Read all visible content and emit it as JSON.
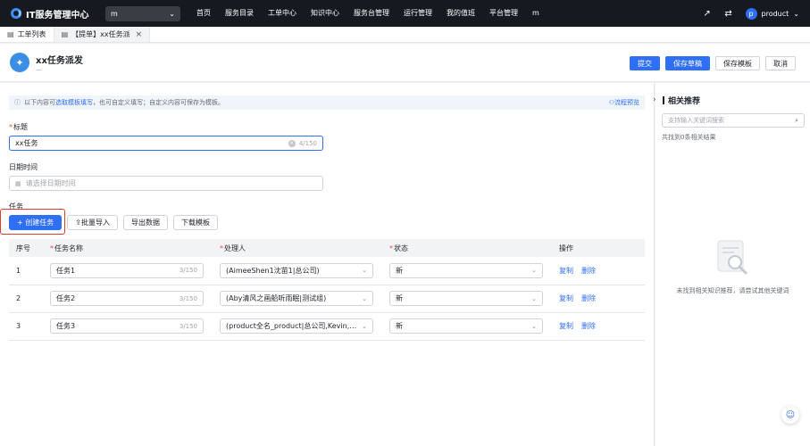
{
  "topnav": {
    "app_title": "IT服务管理中心",
    "system_select": "m",
    "items": [
      "首页",
      "服务目录",
      "工单中心",
      "知识中心",
      "服务台管理",
      "运行管理",
      "我的值班",
      "平台管理",
      "m"
    ],
    "user_initial": "p",
    "user_name": "product"
  },
  "tabs": [
    {
      "label": "工单列表",
      "icon": "document-icon"
    },
    {
      "label": "【提单】xx任务派",
      "icon": "document-icon",
      "close": "×"
    }
  ],
  "header": {
    "title": "xx任务派发",
    "subtitle": "—",
    "buttons": {
      "submit": "提交",
      "save_draft": "保存草稿",
      "save_template": "保存模板",
      "cancel": "取消"
    }
  },
  "notice": {
    "prefix": "以下内容可",
    "link": "选取模板填写",
    "suffix": "，也可自定义填写；自定义内容可保存为模板。",
    "flow_preview": "流程预览"
  },
  "form": {
    "title_label": "标题",
    "title_value": "xx任务",
    "title_counter": "4/150",
    "date_label": "日期时间",
    "date_placeholder": "请选择日期时间",
    "task_label": "任务"
  },
  "toolbar": {
    "create": "+ 创建任务",
    "batch_import": "批量导入",
    "export": "导出数据",
    "download_template": "下载模板"
  },
  "table": {
    "headers": [
      "序号",
      "任务名称",
      "处理人",
      "状态",
      "操作"
    ],
    "rows": [
      {
        "no": "1",
        "name": "任务1",
        "counter": "3/150",
        "handler": "(AimeeShen1沈苗1|总公司)",
        "status": "新",
        "copy": "复制",
        "delete": "删除"
      },
      {
        "no": "2",
        "name": "任务2",
        "counter": "3/150",
        "handler": "(Aby清风之画船听雨眠|测试组)",
        "status": "新",
        "copy": "复制",
        "delete": "删除"
      },
      {
        "no": "3",
        "name": "任务3",
        "counter": "3/150",
        "handler": "(product全名_product|总公司,Kevin,设计...",
        "status": "新",
        "copy": "复制",
        "delete": "删除"
      }
    ]
  },
  "side": {
    "title": "相关推荐",
    "search_placeholder": "支持输入关键词搜索",
    "result_count": "共找到0条相关结果",
    "empty_text": "未找到相关知识推荐，请尝试其他关键词"
  },
  "colors": {
    "primary": "#2f6ef6",
    "nav_bg": "#16191f",
    "highlight": "#e23b2f"
  }
}
